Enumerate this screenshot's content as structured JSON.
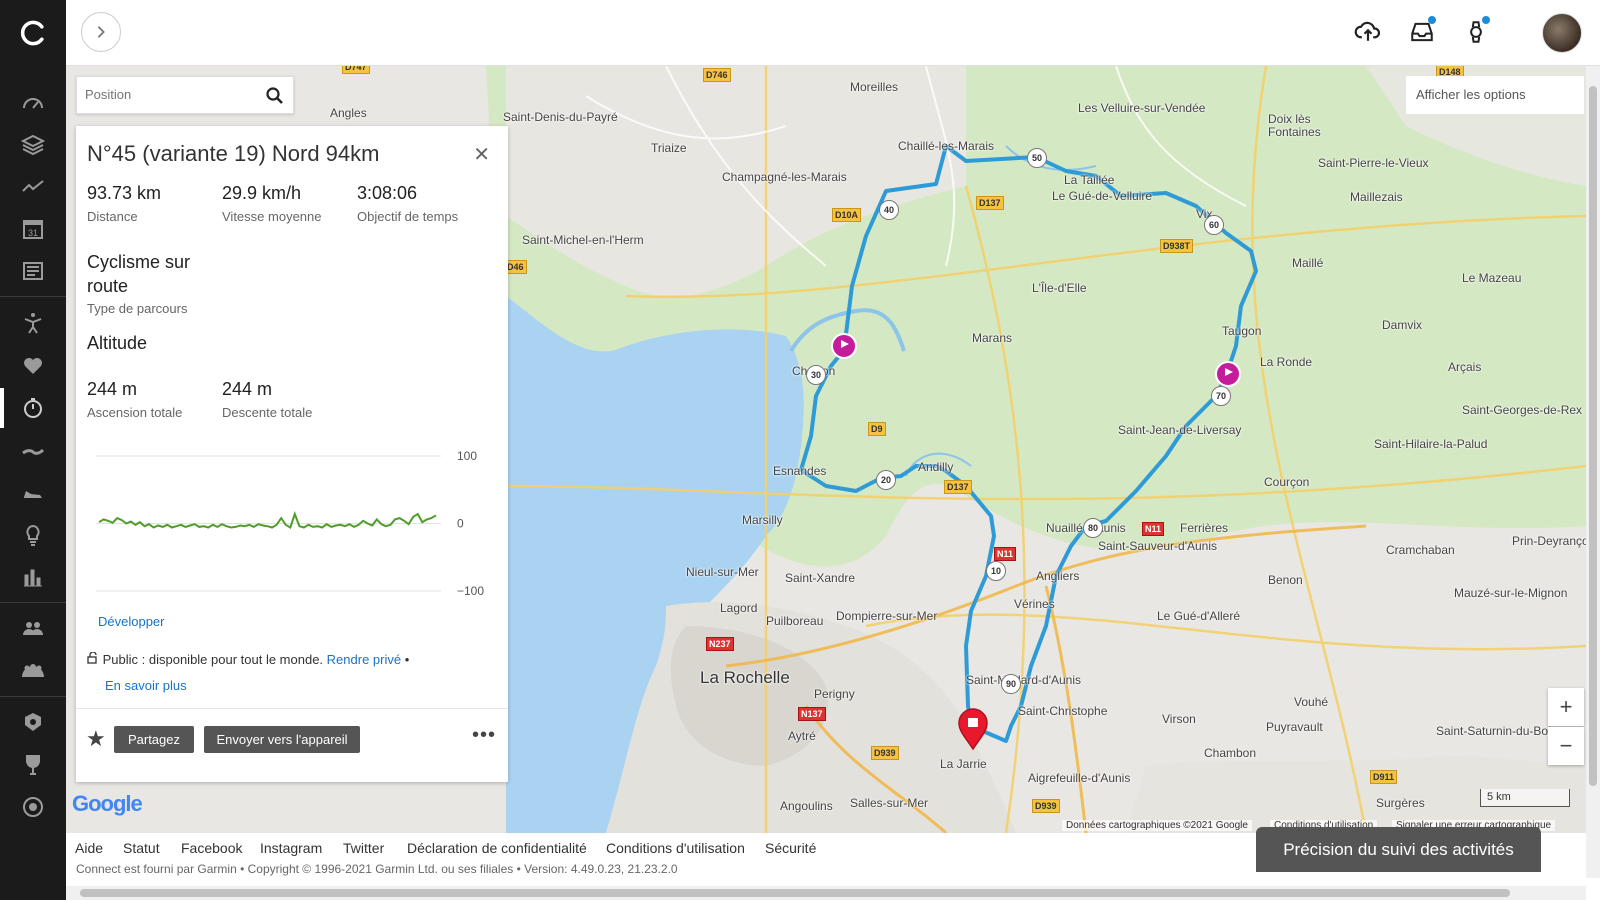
{
  "sidebar": {
    "items": [
      "dashboard-icon",
      "layers-icon",
      "activity-icon",
      "calendar-icon",
      "news-icon",
      "training-icon",
      "health-icon",
      "stopwatch-icon",
      "cycling-icon",
      "shoe-icon",
      "insights-icon",
      "reports-icon",
      "connections-icon",
      "groups-icon",
      "badges-icon",
      "trophy-icon",
      "segments-icon"
    ],
    "calendar_day": "31"
  },
  "topbar": {
    "icons": [
      "upload-icon",
      "inbox-icon",
      "device-icon"
    ]
  },
  "map": {
    "search_placeholder": "Position",
    "options_label": "Afficher les options",
    "places": [
      {
        "name": "Moreilles"
      },
      {
        "name": "Les Velluire-sur-Vendée"
      },
      {
        "name": "Doix lès Fontaines"
      },
      {
        "name": "Saint-Denis-du-Payré"
      },
      {
        "name": "Angles"
      },
      {
        "name": "Triaize"
      },
      {
        "name": "Chaillé-les-Marais"
      },
      {
        "name": "La Taillée"
      },
      {
        "name": "Le Gué-de-Velluire"
      },
      {
        "name": "Saint-Pierre-le-Vieux"
      },
      {
        "name": "Maillezais"
      },
      {
        "name": "Champagné-les-Marais"
      },
      {
        "name": "Saint-Michel-en-l'Herm"
      },
      {
        "name": "Vix"
      },
      {
        "name": "Maillé"
      },
      {
        "name": "Le Mazeau"
      },
      {
        "name": "L'Île-d'Elle"
      },
      {
        "name": "Damvix"
      },
      {
        "name": "Marans"
      },
      {
        "name": "Taugon"
      },
      {
        "name": "La Ronde"
      },
      {
        "name": "Arçais"
      },
      {
        "name": "Charron"
      },
      {
        "name": "Saint-Georges-de-Rex"
      },
      {
        "name": "Saint-Jean-de-Liversay"
      },
      {
        "name": "Saint-Hilaire-la-Palud"
      },
      {
        "name": "Esnandes"
      },
      {
        "name": "Andilly"
      },
      {
        "name": "Courçon"
      },
      {
        "name": "Marsilly"
      },
      {
        "name": "Nuaillé-d'Aunis"
      },
      {
        "name": "Ferrières"
      },
      {
        "name": "Saint-Sauveur-d'Aunis"
      },
      {
        "name": "Cramchaban"
      },
      {
        "name": "Prin-Deyrançon"
      },
      {
        "name": "Nieul-sur-Mer"
      },
      {
        "name": "Saint-Xandre"
      },
      {
        "name": "Angliers"
      },
      {
        "name": "Benon"
      },
      {
        "name": "Mauzé-sur-le-Mignon"
      },
      {
        "name": "Lagord"
      },
      {
        "name": "Puilboreau"
      },
      {
        "name": "Dompierre-sur-Mer"
      },
      {
        "name": "Vérines"
      },
      {
        "name": "Le Gué-d'Alleré"
      },
      {
        "name": "La Rochelle",
        "big": true
      },
      {
        "name": "Saint-Médard-d'Aunis"
      },
      {
        "name": "Perigny"
      },
      {
        "name": "Saint-Christophe"
      },
      {
        "name": "Vouhé"
      },
      {
        "name": "Virson"
      },
      {
        "name": "Puyravault"
      },
      {
        "name": "Saint-Saturnin-du-Bois"
      },
      {
        "name": "Aytré"
      },
      {
        "name": "Chambon"
      },
      {
        "name": "La Jarrie"
      },
      {
        "name": "Aigrefeuille-d'Aunis"
      },
      {
        "name": "Angoulins"
      },
      {
        "name": "Salles-sur-Mer"
      },
      {
        "name": "Surgères"
      }
    ],
    "roads": [
      {
        "label": "D747"
      },
      {
        "label": "D746"
      },
      {
        "label": "D148"
      },
      {
        "label": "D10A"
      },
      {
        "label": "D137"
      },
      {
        "label": "D938T"
      },
      {
        "label": "D46"
      },
      {
        "label": "D9"
      },
      {
        "label": "D137"
      },
      {
        "label": "N11",
        "red": true
      },
      {
        "label": "N11",
        "red": true
      },
      {
        "label": "N237",
        "red": true
      },
      {
        "label": "N137",
        "red": true
      },
      {
        "label": "D939"
      },
      {
        "label": "D939"
      },
      {
        "label": "D911"
      }
    ],
    "km_markers": [
      "50",
      "40",
      "60",
      "30",
      "70",
      "20",
      "80",
      "10",
      "90"
    ],
    "zoom_in": "+",
    "zoom_out": "−",
    "scale_label": "5 km",
    "attribution": "Données cartographiques ©2021 Google",
    "terms": "Conditions d'utilisation",
    "report": "Signaler une erreur cartographique",
    "google_logo": "Google"
  },
  "course": {
    "title": "N°45 (variante 19) Nord 94km",
    "distance": "93.73 km",
    "distance_label": "Distance",
    "speed": "29.9 km/h",
    "speed_label": "Vitesse moyenne",
    "time": "3:08:06",
    "time_label": "Objectif de temps",
    "type": "Cyclisme sur route",
    "type_label": "Type de parcours",
    "altitude_heading": "Altitude",
    "ascent": "244 m",
    "ascent_label": "Ascension totale",
    "descent": "244 m",
    "descent_label": "Descente totale",
    "expand": "Développer",
    "public_text": "Public : disponible pour tout le monde.",
    "make_private": "Rendre privé",
    "learn_more": "En savoir plus",
    "share": "Partagez",
    "send": "Envoyer vers l'appareil",
    "more": "•••"
  },
  "chart_data": {
    "type": "line",
    "ylabel": "",
    "yticks": [
      "100",
      "0",
      "−100"
    ],
    "ylim": [
      -100,
      100
    ],
    "series": [
      {
        "values": [
          2,
          6,
          4,
          1,
          8,
          5,
          0,
          3,
          -2,
          2,
          -4,
          -1,
          -6,
          -3,
          -5,
          -2,
          -6,
          -4,
          -2,
          -5,
          -3,
          -1,
          -5,
          -4,
          -6,
          -2,
          -5,
          -1,
          -4,
          -6,
          -5,
          -3,
          -4,
          -2,
          -5,
          -1,
          -3,
          -4,
          -6,
          -2,
          8,
          -2,
          -6,
          14,
          -4,
          -6,
          -2,
          -5,
          -4,
          -6,
          -1,
          -5,
          -3,
          -2,
          -4,
          -1,
          -5,
          -2,
          4,
          0,
          -3,
          6,
          -1,
          -4,
          -2,
          6,
          8,
          4,
          -1,
          10,
          14,
          2,
          6,
          8,
          12
        ]
      }
    ]
  },
  "footer": {
    "links": [
      "Aide",
      "Statut",
      "Facebook",
      "Instagram",
      "Twitter",
      "Déclaration de confidentialité",
      "Conditions d'utilisation",
      "Sécurité"
    ],
    "copyright": "Connect est fourni par Garmin • Copyright © 1996-2021 Garmin Ltd. ou ses filiales • Version: 4.49.0.23, 21.23.2.0",
    "precision_button": "Précision du suivi des activités"
  }
}
